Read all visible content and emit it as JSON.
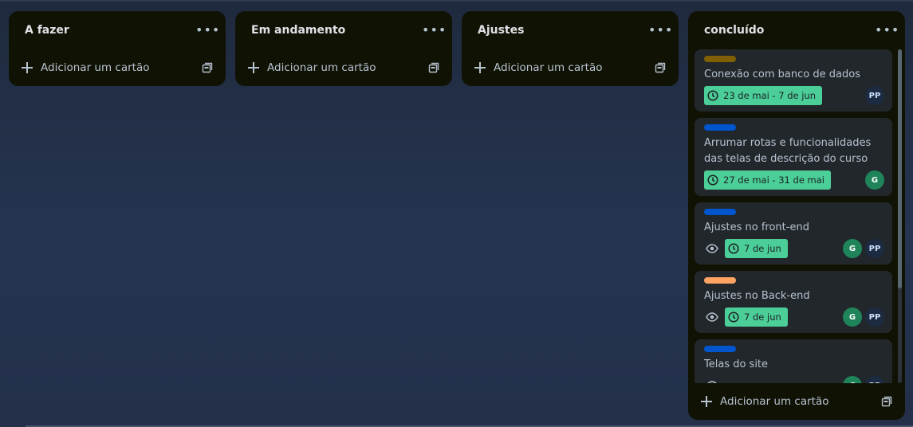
{
  "colors": {
    "list_bg": "#101204",
    "card_bg": "#22272b",
    "date_green": "#4bce97",
    "label_olive": "#7f5f01",
    "label_blue": "#0055cc",
    "label_orange": "#fea362",
    "avatar_green": "#1f845a",
    "avatar_pp": "#1c2b41"
  },
  "common": {
    "add_card_label": "Adicionar um cartão",
    "more_icon": "•••"
  },
  "lists": [
    {
      "title": "A fazer"
    },
    {
      "title": "Em andamento"
    },
    {
      "title": "Ajustes"
    },
    {
      "title": "concluído"
    }
  ],
  "cards": [
    {
      "label_color": "olive",
      "title": "Conexão com banco de dados",
      "date": "23 de mai - 7 de jun",
      "watch": false,
      "members": [
        "PP"
      ]
    },
    {
      "label_color": "blue",
      "title": "Arrumar rotas e funcionalidades das telas de descrição do curso",
      "date": "27 de mai - 31 de mai",
      "watch": false,
      "members": [
        "G"
      ]
    },
    {
      "label_color": "blue",
      "title": "Ajustes no front-end",
      "date": "7 de jun",
      "watch": true,
      "members": [
        "G",
        "PP"
      ]
    },
    {
      "label_color": "orange",
      "title": "Ajustes no Back-end",
      "date": "7 de jun",
      "watch": true,
      "members": [
        "G",
        "PP"
      ]
    },
    {
      "label_color": "blue",
      "title": "Telas do site",
      "watch": true,
      "members": [
        "G",
        "PP"
      ]
    }
  ]
}
